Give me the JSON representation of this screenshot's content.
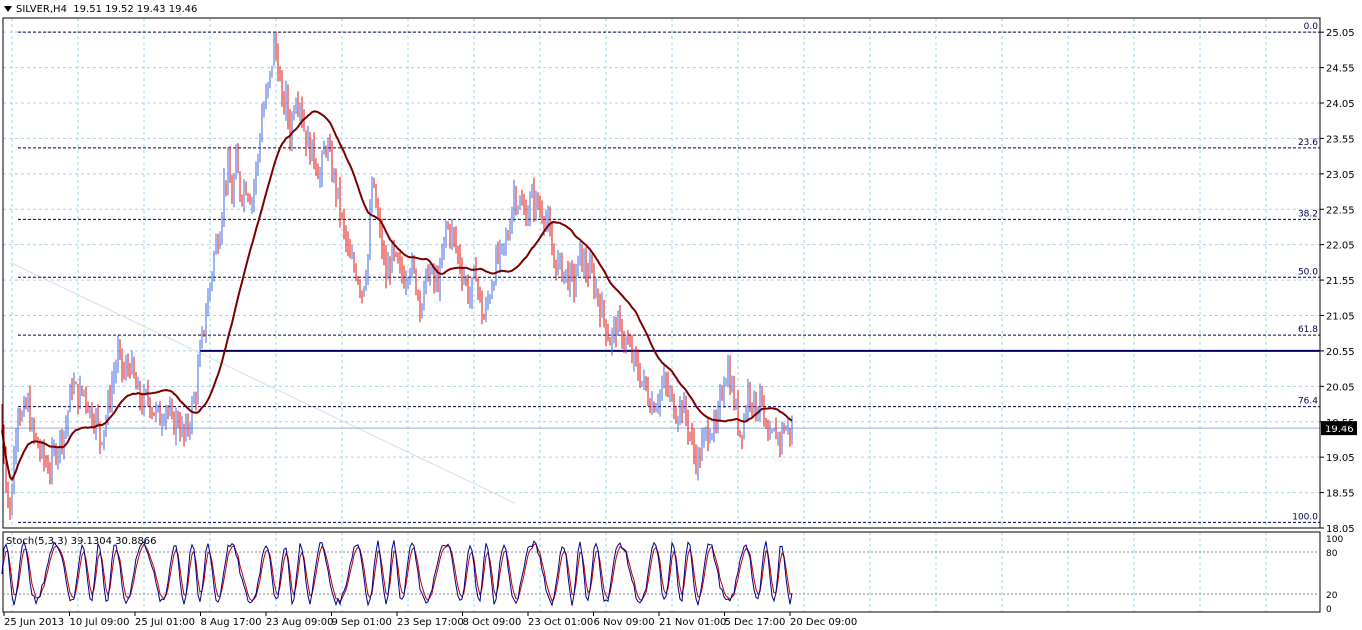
{
  "header": {
    "symbol_tf": "SILVER,H4",
    "ohlc": "19.51 19.52 19.43 19.46"
  },
  "stoch_label": "Stoch(5,3,3) 39.1304 30.8866",
  "colors": {
    "bull": "#4169e1",
    "bear": "#e01010",
    "ma": "#7a0000",
    "support": "#00005a",
    "grid": "#a8d4e6",
    "fib": "#000050",
    "stoch_main": "#00008b",
    "stoch_signal": "#c00000"
  },
  "chart_data": [
    {
      "type": "candlestick",
      "symbol": "SILVER",
      "timeframe": "H4",
      "ylim": [
        18.05,
        25.25
      ],
      "y_ticks": [
        25.05,
        24.55,
        24.05,
        23.55,
        23.05,
        22.55,
        22.05,
        21.55,
        21.05,
        20.55,
        20.05,
        19.55,
        19.05,
        18.55,
        18.05
      ],
      "x_labels": [
        "25 Jun 2013",
        "10 Jul 09:00",
        "25 Jul 01:00",
        "8 Aug 17:00",
        "23 Aug 09:00",
        "9 Sep 01:00",
        "23 Sep 17:00",
        "8 Oct 09:00",
        "23 Oct 01:00",
        "6 Nov 09:00",
        "21 Nov 01:00",
        "5 Dec 17:00",
        "20 Dec 09:00"
      ],
      "price_path": [
        [
          0,
          19.7
        ],
        [
          3,
          19.3
        ],
        [
          6,
          18.8
        ],
        [
          10,
          18.2
        ],
        [
          14,
          19.1
        ],
        [
          18,
          19.8
        ],
        [
          22,
          19.6
        ],
        [
          28,
          19.8
        ],
        [
          32,
          19.4
        ],
        [
          38,
          19.2
        ],
        [
          44,
          19.0
        ],
        [
          50,
          18.9
        ],
        [
          54,
          19.1
        ],
        [
          60,
          19.3
        ],
        [
          66,
          19.5
        ],
        [
          72,
          20.1
        ],
        [
          78,
          19.9
        ],
        [
          84,
          20.0
        ],
        [
          90,
          19.7
        ],
        [
          96,
          19.6
        ],
        [
          100,
          19.3
        ],
        [
          106,
          19.6
        ],
        [
          112,
          20.1
        ],
        [
          118,
          20.5
        ],
        [
          124,
          20.2
        ],
        [
          130,
          20.4
        ],
        [
          136,
          20.0
        ],
        [
          142,
          19.8
        ],
        [
          148,
          19.9
        ],
        [
          154,
          19.7
        ],
        [
          160,
          19.6
        ],
        [
          166,
          19.8
        ],
        [
          172,
          19.5
        ],
        [
          178,
          19.6
        ],
        [
          184,
          19.3
        ],
        [
          190,
          19.6
        ],
        [
          196,
          20.0
        ],
        [
          200,
          20.5
        ],
        [
          205,
          21.0
        ],
        [
          210,
          21.5
        ],
        [
          215,
          22.0
        ],
        [
          220,
          22.3
        ],
        [
          224,
          22.9
        ],
        [
          228,
          23.1
        ],
        [
          232,
          22.7
        ],
        [
          236,
          23.2
        ],
        [
          240,
          22.8
        ],
        [
          246,
          22.9
        ],
        [
          252,
          22.7
        ],
        [
          258,
          23.3
        ],
        [
          262,
          23.9
        ],
        [
          266,
          24.1
        ],
        [
          270,
          24.4
        ],
        [
          274,
          24.9
        ],
        [
          278,
          24.6
        ],
        [
          282,
          24.0
        ],
        [
          286,
          24.1
        ],
        [
          290,
          23.6
        ],
        [
          295,
          24.2
        ],
        [
          300,
          24.1
        ],
        [
          305,
          23.6
        ],
        [
          310,
          23.4
        ],
        [
          315,
          23.3
        ],
        [
          320,
          23.0
        ],
        [
          326,
          23.5
        ],
        [
          332,
          23.1
        ],
        [
          338,
          22.7
        ],
        [
          344,
          22.2
        ],
        [
          350,
          21.8
        ],
        [
          356,
          21.7
        ],
        [
          362,
          21.4
        ],
        [
          368,
          21.9
        ],
        [
          372,
          22.9
        ],
        [
          376,
          22.6
        ],
        [
          380,
          22.2
        ],
        [
          386,
          21.6
        ],
        [
          392,
          21.9
        ],
        [
          398,
          21.7
        ],
        [
          404,
          21.6
        ],
        [
          410,
          21.8
        ],
        [
          416,
          21.5
        ],
        [
          422,
          21.2
        ],
        [
          428,
          21.7
        ],
        [
          434,
          21.5
        ],
        [
          440,
          21.6
        ],
        [
          446,
          22.3
        ],
        [
          452,
          22.2
        ],
        [
          458,
          21.9
        ],
        [
          464,
          21.6
        ],
        [
          470,
          21.3
        ],
        [
          476,
          21.7
        ],
        [
          480,
          21.2
        ],
        [
          484,
          21.0
        ],
        [
          490,
          21.4
        ],
        [
          496,
          21.8
        ],
        [
          502,
          21.9
        ],
        [
          508,
          22.2
        ],
        [
          514,
          22.8
        ],
        [
          520,
          22.6
        ],
        [
          526,
          22.5
        ],
        [
          532,
          22.7
        ],
        [
          538,
          22.6
        ],
        [
          544,
          22.5
        ],
        [
          548,
          22.3
        ],
        [
          552,
          21.9
        ],
        [
          556,
          21.8
        ],
        [
          562,
          21.7
        ],
        [
          568,
          21.6
        ],
        [
          574,
          21.5
        ],
        [
          580,
          21.9
        ],
        [
          586,
          21.7
        ],
        [
          592,
          21.6
        ],
        [
          598,
          21.3
        ],
        [
          604,
          21.0
        ],
        [
          610,
          20.7
        ],
        [
          616,
          20.9
        ],
        [
          622,
          20.8
        ],
        [
          628,
          20.6
        ],
        [
          634,
          20.4
        ],
        [
          640,
          20.2
        ],
        [
          646,
          20.0
        ],
        [
          652,
          19.8
        ],
        [
          658,
          19.9
        ],
        [
          664,
          20.1
        ],
        [
          670,
          19.9
        ],
        [
          676,
          19.7
        ],
        [
          682,
          19.8
        ],
        [
          688,
          19.5
        ],
        [
          694,
          19.1
        ],
        [
          698,
          19.0
        ],
        [
          704,
          19.3
        ],
        [
          710,
          19.5
        ],
        [
          716,
          19.4
        ],
        [
          720,
          19.8
        ],
        [
          724,
          20.2
        ],
        [
          728,
          20.3
        ],
        [
          732,
          20.0
        ],
        [
          736,
          19.7
        ],
        [
          740,
          19.4
        ],
        [
          744,
          19.6
        ],
        [
          748,
          20.0
        ],
        [
          752,
          19.9
        ],
        [
          756,
          19.7
        ],
        [
          760,
          20.0
        ],
        [
          764,
          19.5
        ],
        [
          768,
          19.2
        ],
        [
          772,
          19.3
        ],
        [
          776,
          19.4
        ],
        [
          780,
          19.3
        ],
        [
          784,
          19.5
        ],
        [
          788,
          19.4
        ],
        [
          792,
          19.46
        ]
      ],
      "fibonacci": {
        "high": 25.05,
        "low": 18.13,
        "levels": [
          {
            "label": "0.0",
            "ratio": 0.0
          },
          {
            "label": "23.6",
            "ratio": 0.236
          },
          {
            "label": "38.2",
            "ratio": 0.382
          },
          {
            "label": "50.0",
            "ratio": 0.5
          },
          {
            "label": "61.8",
            "ratio": 0.618
          },
          {
            "label": "76.4",
            "ratio": 0.764
          },
          {
            "label": "100.0",
            "ratio": 1.0
          }
        ]
      },
      "support_line": 20.55,
      "current_price": "19.46"
    },
    {
      "type": "line",
      "indicator": "Stoch(5,3,3)",
      "ylim": [
        0,
        100
      ],
      "y_ticks": [
        100,
        80,
        20,
        0
      ],
      "levels": [
        80,
        20
      ]
    }
  ]
}
